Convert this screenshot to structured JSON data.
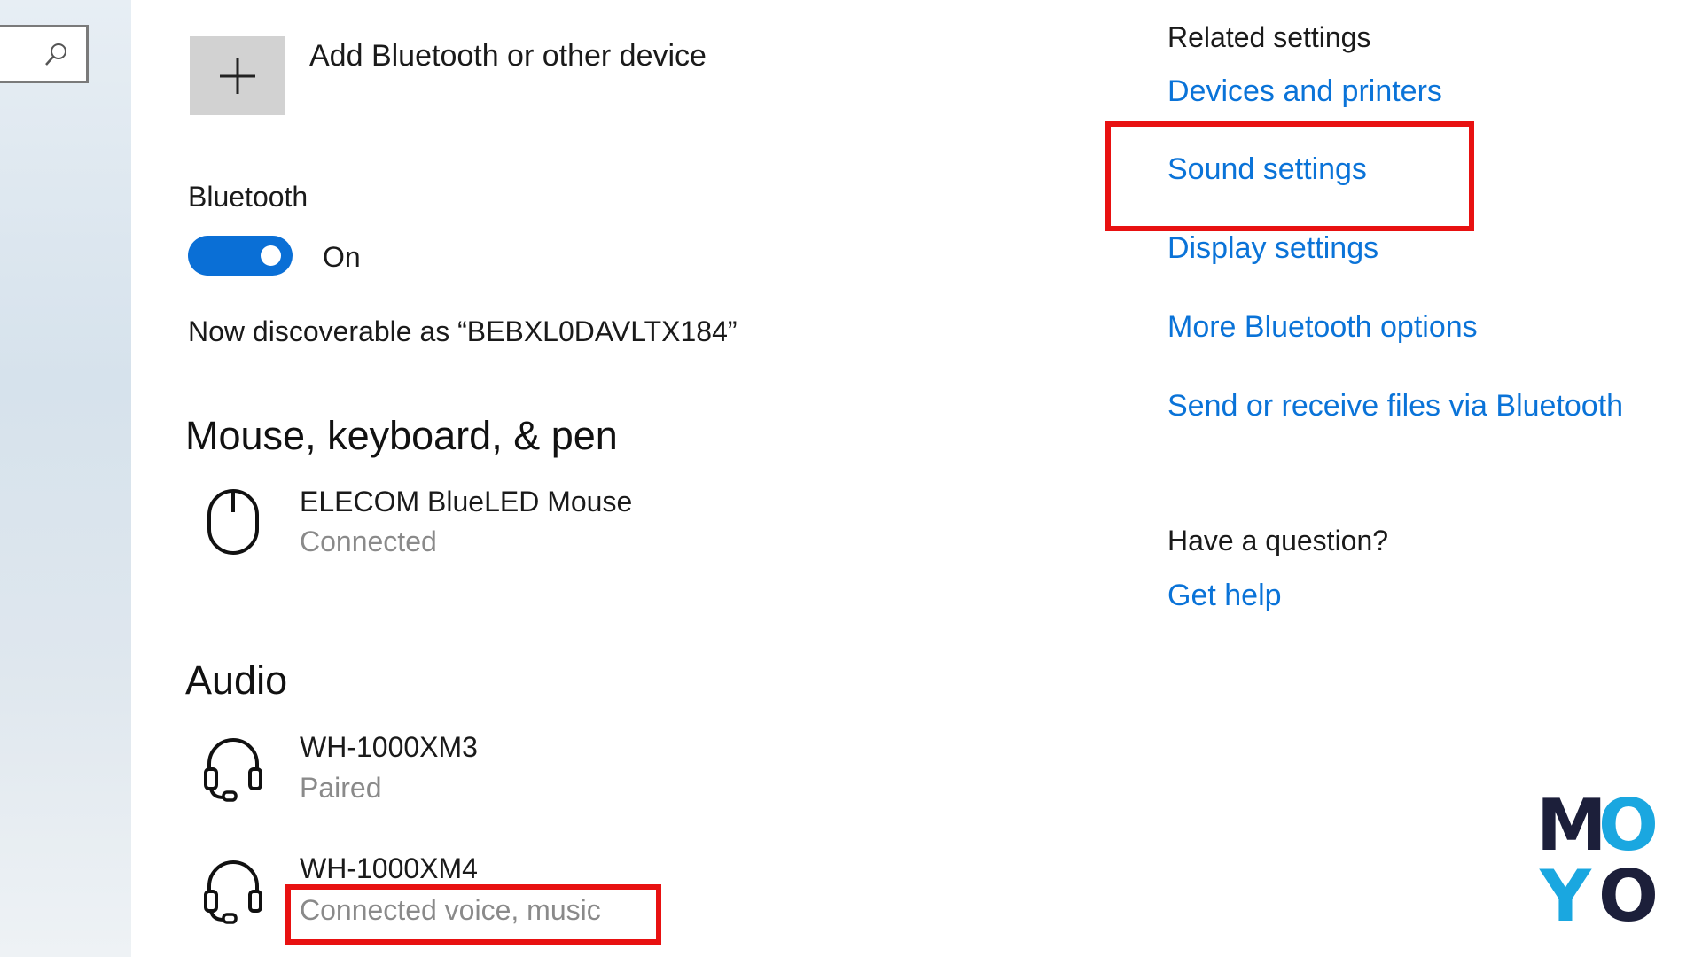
{
  "add_device": {
    "label": "Add Bluetooth or other device"
  },
  "bluetooth": {
    "label": "Bluetooth",
    "state": "On",
    "discoverable": "Now discoverable as “BEBXL0DAVLTX184”"
  },
  "sections": {
    "mouse": {
      "title": "Mouse, keyboard, & pen",
      "devices": [
        {
          "name": "ELECOM BlueLED Mouse",
          "status": "Connected",
          "icon": "mouse-icon"
        }
      ]
    },
    "audio": {
      "title": "Audio",
      "devices": [
        {
          "name": "WH-1000XM3",
          "status": "Paired",
          "icon": "headset-icon"
        },
        {
          "name": "WH-1000XM4",
          "status": "Connected voice, music",
          "icon": "headset-icon"
        }
      ]
    }
  },
  "related": {
    "title": "Related settings",
    "links": [
      "Devices and printers",
      "Sound settings",
      "Display settings",
      "More Bluetooth options",
      "Send or receive files via Bluetooth"
    ]
  },
  "help": {
    "question": "Have a question?",
    "link": "Get help"
  },
  "logo": {
    "letters": [
      "M",
      "O",
      "Y",
      "O"
    ]
  },
  "colors": {
    "accent": "#0a73d8",
    "toggle": "#0a6fd6",
    "highlight": "#e81111",
    "logo_dark": "#1c1f3a",
    "logo_blue": "#1aa7e0"
  }
}
